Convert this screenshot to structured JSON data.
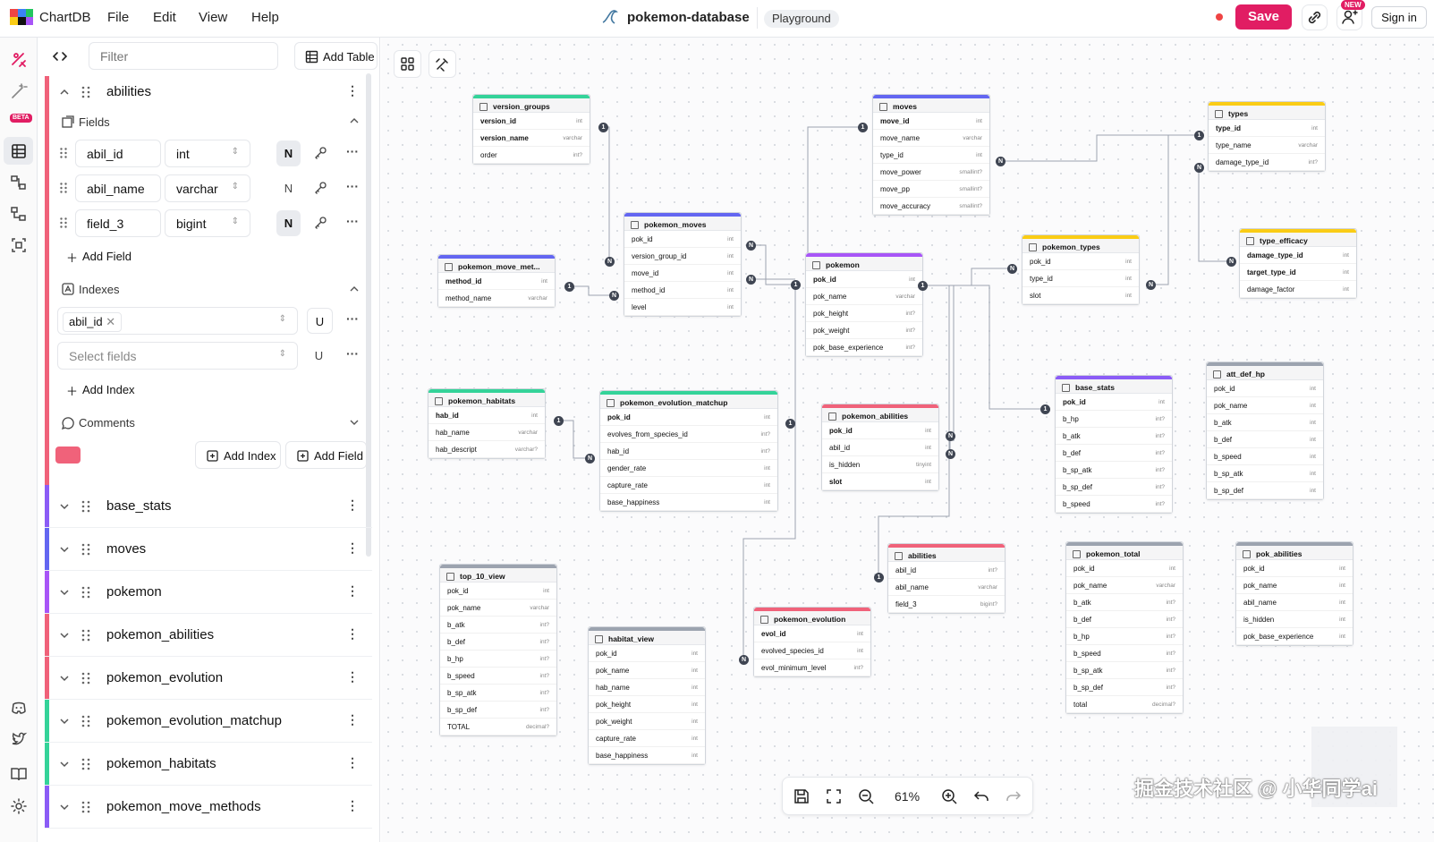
{
  "app": {
    "brand": "ChartDB",
    "menu": [
      "File",
      "Edit",
      "View",
      "Help"
    ],
    "project_name": "pokemon-database",
    "badge": "Playground",
    "save_label": "Save",
    "new_badge": "NEW",
    "signin_label": "Sign in",
    "beta_badge": "BETA",
    "unsaved_color": "#ef4444",
    "accent": "#e11d63"
  },
  "sidebar": {
    "filter_placeholder": "Filter",
    "add_table_label": "Add Table",
    "open_table": {
      "name": "abilities",
      "color": "#f0627a",
      "fields_label": "Fields",
      "fields": [
        {
          "name": "abil_id",
          "type": "int",
          "nullable": "N"
        },
        {
          "name": "abil_name",
          "type": "varchar",
          "nullable": "N"
        },
        {
          "name": "field_3",
          "type": "bigint",
          "nullable": "N"
        }
      ],
      "add_field_label": "Add Field",
      "indexes_label": "Indexes",
      "index_tag": "abil_id",
      "index_unique": "U",
      "select_fields_placeholder": "Select fields",
      "add_index_label": "Add Index",
      "comments_label": "Comments",
      "bottom_add_index": "Add Index",
      "bottom_add_field": "Add Field"
    },
    "tables": [
      {
        "name": "base_stats",
        "color": "#8b5cf6"
      },
      {
        "name": "moves",
        "color": "#6366f1"
      },
      {
        "name": "pokemon",
        "color": "#a855f7"
      },
      {
        "name": "pokemon_abilities",
        "color": "#f0627a"
      },
      {
        "name": "pokemon_evolution",
        "color": "#f0627a"
      },
      {
        "name": "pokemon_evolution_matchup",
        "color": "#34d399"
      },
      {
        "name": "pokemon_habitats",
        "color": "#34d399"
      },
      {
        "name": "pokemon_move_methods",
        "color": "#8b5cf6"
      }
    ]
  },
  "canvas": {
    "zoom_level": "61%",
    "watermark": "掘金技术社区 @ 小华同学ai",
    "tables": [
      {
        "name": "version_groups",
        "color": "#34d399",
        "fields": [
          [
            "version_id",
            "int",
            true
          ],
          [
            "version_name",
            "varchar",
            true
          ],
          [
            "order",
            "int?",
            false
          ]
        ]
      },
      {
        "name": "moves",
        "color": "#6366f1",
        "fields": [
          [
            "move_id",
            "int",
            true
          ],
          [
            "move_name",
            "varchar",
            false
          ],
          [
            "type_id",
            "int",
            false
          ],
          [
            "move_power",
            "smallint?",
            false
          ],
          [
            "move_pp",
            "smallint?",
            false
          ],
          [
            "move_accuracy",
            "smallint?",
            false
          ]
        ]
      },
      {
        "name": "types",
        "color": "#facc15",
        "fields": [
          [
            "type_id",
            "int",
            true
          ],
          [
            "type_name",
            "varchar",
            false
          ],
          [
            "damage_type_id",
            "int?",
            false
          ]
        ]
      },
      {
        "name": "pokemon_moves",
        "color": "#6366f1",
        "fields": [
          [
            "pok_id",
            "int",
            false
          ],
          [
            "version_group_id",
            "int",
            false
          ],
          [
            "move_id",
            "int",
            false
          ],
          [
            "method_id",
            "int",
            false
          ],
          [
            "level",
            "int",
            false
          ]
        ]
      },
      {
        "name": "pokemon_move_met...",
        "color": "#6366f1",
        "fields": [
          [
            "method_id",
            "int",
            true
          ],
          [
            "method_name",
            "varchar",
            false
          ]
        ]
      },
      {
        "name": "pokemon",
        "color": "#a855f7",
        "fields": [
          [
            "pok_id",
            "int",
            true
          ],
          [
            "pok_name",
            "varchar",
            false
          ],
          [
            "pok_height",
            "int?",
            false
          ],
          [
            "pok_weight",
            "int?",
            false
          ],
          [
            "pok_base_experience",
            "int?",
            false
          ]
        ]
      },
      {
        "name": "pokemon_types",
        "color": "#facc15",
        "fields": [
          [
            "pok_id",
            "int",
            false
          ],
          [
            "type_id",
            "int",
            false
          ],
          [
            "slot",
            "int",
            false
          ]
        ]
      },
      {
        "name": "type_efficacy",
        "color": "#facc15",
        "fields": [
          [
            "damage_type_id",
            "int",
            true
          ],
          [
            "target_type_id",
            "int",
            true
          ],
          [
            "damage_factor",
            "int",
            false
          ]
        ]
      },
      {
        "name": "pokemon_habitats",
        "color": "#34d399",
        "fields": [
          [
            "hab_id",
            "int",
            true
          ],
          [
            "hab_name",
            "varchar",
            false
          ],
          [
            "hab_descript",
            "varchar?",
            false
          ]
        ]
      },
      {
        "name": "pokemon_evolution_matchup",
        "color": "#34d399",
        "fields": [
          [
            "pok_id",
            "int",
            true
          ],
          [
            "evolves_from_species_id",
            "int?",
            false
          ],
          [
            "hab_id",
            "int?",
            false
          ],
          [
            "gender_rate",
            "int",
            false
          ],
          [
            "capture_rate",
            "int",
            false
          ],
          [
            "base_happiness",
            "int",
            false
          ]
        ]
      },
      {
        "name": "pokemon_abilities",
        "color": "#f0627a",
        "fields": [
          [
            "pok_id",
            "int",
            true
          ],
          [
            "abil_id",
            "int",
            false
          ],
          [
            "is_hidden",
            "tinyint",
            false
          ],
          [
            "slot",
            "int",
            true
          ]
        ]
      },
      {
        "name": "base_stats",
        "color": "#8b5cf6",
        "fields": [
          [
            "pok_id",
            "int",
            true
          ],
          [
            "b_hp",
            "int?",
            false
          ],
          [
            "b_atk",
            "int?",
            false
          ],
          [
            "b_def",
            "int?",
            false
          ],
          [
            "b_sp_atk",
            "int?",
            false
          ],
          [
            "b_sp_def",
            "int?",
            false
          ],
          [
            "b_speed",
            "int?",
            false
          ]
        ]
      },
      {
        "name": "att_def_hp",
        "color": "#9ca3af",
        "fields": [
          [
            "pok_id",
            "int",
            false
          ],
          [
            "pok_name",
            "int",
            false
          ],
          [
            "b_atk",
            "int",
            false
          ],
          [
            "b_def",
            "int",
            false
          ],
          [
            "b_speed",
            "int",
            false
          ],
          [
            "b_sp_atk",
            "int",
            false
          ],
          [
            "b_sp_def",
            "int",
            false
          ]
        ]
      },
      {
        "name": "top_10_view",
        "color": "#9ca3af",
        "fields": [
          [
            "pok_id",
            "int",
            false
          ],
          [
            "pok_name",
            "varchar",
            false
          ],
          [
            "b_atk",
            "int?",
            false
          ],
          [
            "b_def",
            "int?",
            false
          ],
          [
            "b_hp",
            "int?",
            false
          ],
          [
            "b_speed",
            "int?",
            false
          ],
          [
            "b_sp_atk",
            "int?",
            false
          ],
          [
            "b_sp_def",
            "int?",
            false
          ],
          [
            "TOTAL",
            "decimal?",
            false
          ]
        ]
      },
      {
        "name": "habitat_view",
        "color": "#9ca3af",
        "fields": [
          [
            "pok_id",
            "int",
            false
          ],
          [
            "pok_name",
            "int",
            false
          ],
          [
            "hab_name",
            "int",
            false
          ],
          [
            "pok_height",
            "int",
            false
          ],
          [
            "pok_weight",
            "int",
            false
          ],
          [
            "capture_rate",
            "int",
            false
          ],
          [
            "base_happiness",
            "int",
            false
          ]
        ]
      },
      {
        "name": "pokemon_evolution",
        "color": "#f0627a",
        "fields": [
          [
            "evol_id",
            "int",
            true
          ],
          [
            "evolved_species_id",
            "int",
            false
          ],
          [
            "evol_minimum_level",
            "int?",
            false
          ]
        ]
      },
      {
        "name": "abilities",
        "color": "#f0627a",
        "fields": [
          [
            "abil_id",
            "int?",
            false
          ],
          [
            "abil_name",
            "varchar",
            false
          ],
          [
            "field_3",
            "bigint?",
            false
          ]
        ]
      },
      {
        "name": "pokemon_total",
        "color": "#9ca3af",
        "fields": [
          [
            "pok_id",
            "int",
            false
          ],
          [
            "pok_name",
            "varchar",
            false
          ],
          [
            "b_atk",
            "int?",
            false
          ],
          [
            "b_def",
            "int?",
            false
          ],
          [
            "b_hp",
            "int?",
            false
          ],
          [
            "b_speed",
            "int?",
            false
          ],
          [
            "b_sp_atk",
            "int?",
            false
          ],
          [
            "b_sp_def",
            "int?",
            false
          ],
          [
            "total",
            "decimal?",
            false
          ]
        ]
      },
      {
        "name": "pok_abilities",
        "color": "#9ca3af",
        "fields": [
          [
            "pok_id",
            "int",
            false
          ],
          [
            "pok_name",
            "int",
            false
          ],
          [
            "abil_name",
            "int",
            false
          ],
          [
            "is_hidden",
            "int",
            false
          ],
          [
            "pok_base_experience",
            "int",
            false
          ]
        ]
      }
    ]
  }
}
